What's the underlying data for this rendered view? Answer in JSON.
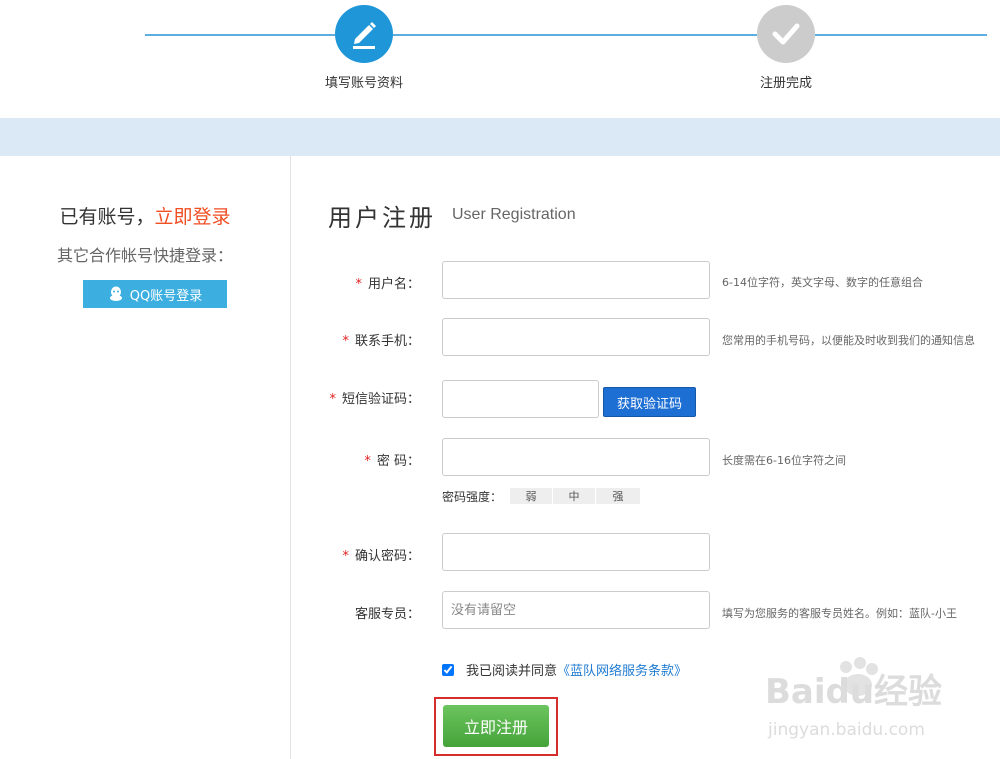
{
  "steps": [
    {
      "label": "填写账号资料",
      "icon": "edit-icon",
      "active": true,
      "color": "#1e96d8"
    },
    {
      "label": "注册完成",
      "icon": "check-icon",
      "active": false,
      "color": "#cccccc"
    }
  ],
  "left": {
    "have_account_text": "已有账号，",
    "login_link": "立即登录",
    "partner_text": "其它合作帐号快捷登录：",
    "qq_button": "QQ账号登录"
  },
  "form": {
    "title": "用户注册",
    "subtitle": "User Registration",
    "fields": {
      "username": {
        "label": "用户名：",
        "required": true,
        "value": "",
        "hint": "6-14位字符，英文字母、数字的任意组合"
      },
      "phone": {
        "label": "联系手机：",
        "required": true,
        "value": "",
        "hint": "您常用的手机号码，以便能及时收到我们的通知信息"
      },
      "sms_code": {
        "label": "短信验证码：",
        "required": true,
        "value": "",
        "button": "获取验证码"
      },
      "password": {
        "label": "密 码：",
        "required": true,
        "value": "",
        "hint": "长度需在6-16位字符之间"
      },
      "confirm_password": {
        "label": "确认密码：",
        "required": true,
        "value": ""
      },
      "service_rep": {
        "label": "客服专员：",
        "required": false,
        "placeholder": "没有请留空",
        "hint": "填写为您服务的客服专员姓名。例如：蓝队-小王"
      }
    },
    "strength": {
      "label": "密码强度：",
      "levels": [
        "弱",
        "中",
        "强"
      ]
    },
    "agree": {
      "checked": true,
      "text": "我已阅读并同意",
      "link": "《蓝队网络服务条款》"
    },
    "submit": "立即注册"
  },
  "watermark": {
    "brand": "Baidu经验",
    "url": "jingyan.baidu.com"
  },
  "colors": {
    "accent": "#1e96d8",
    "banner": "#dbe9f7",
    "link_red": "#f04e23",
    "submit_green": "#4fae42"
  }
}
